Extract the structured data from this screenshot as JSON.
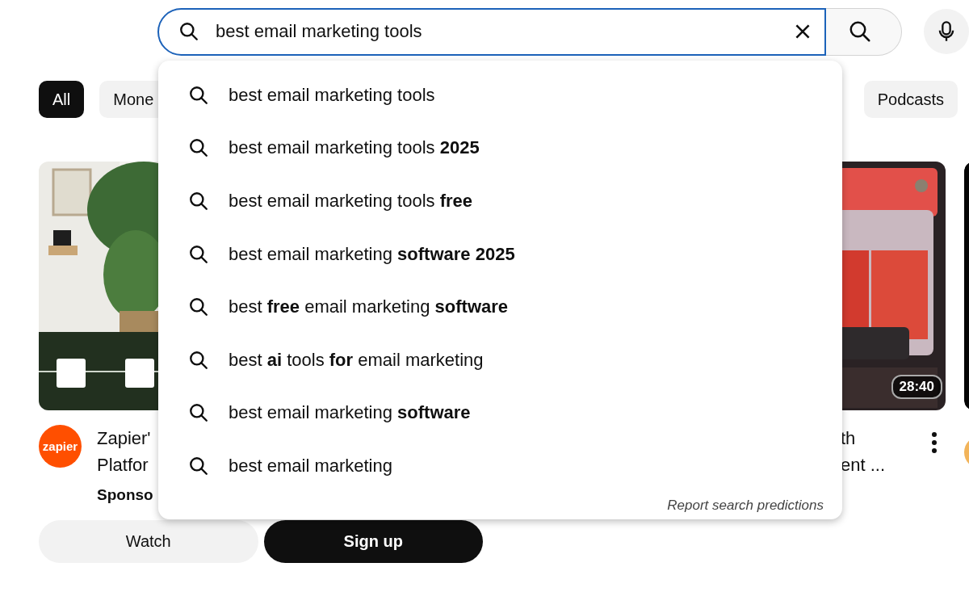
{
  "search": {
    "value": "best email marketing tools",
    "focused": true
  },
  "suggestions": [
    {
      "text": "best email marketing tools"
    },
    {
      "text": "best email marketing tools **2025**"
    },
    {
      "text": "best email marketing tools **free**"
    },
    {
      "text": "best email marketing **software 2025**"
    },
    {
      "text": "best **free** email marketing **software**"
    },
    {
      "text": "best **ai** tools **for** email marketing"
    },
    {
      "text": "best email marketing **software**"
    },
    {
      "text": "best email marketing"
    }
  ],
  "report_link": "Report search predictions",
  "chips": [
    {
      "label": "All",
      "selected": true
    },
    {
      "label": "Mone",
      "selected": false
    },
    {
      "label": "Podcasts",
      "selected": false
    }
  ],
  "cards": [
    {
      "kind": "ad",
      "avatar_text": "zapier",
      "title_lines": [
        "Zapier'",
        "Platfor"
      ],
      "sponsor": "Sponso",
      "buttons": [
        {
          "label": "Watch",
          "primary": false
        },
        {
          "label": "Sign up",
          "primary": true
        }
      ]
    },
    {
      "kind": "video",
      "title_lines": [
        "th",
        "ent ..."
      ],
      "duration": "28:40"
    },
    {
      "kind": "edge"
    }
  ]
}
